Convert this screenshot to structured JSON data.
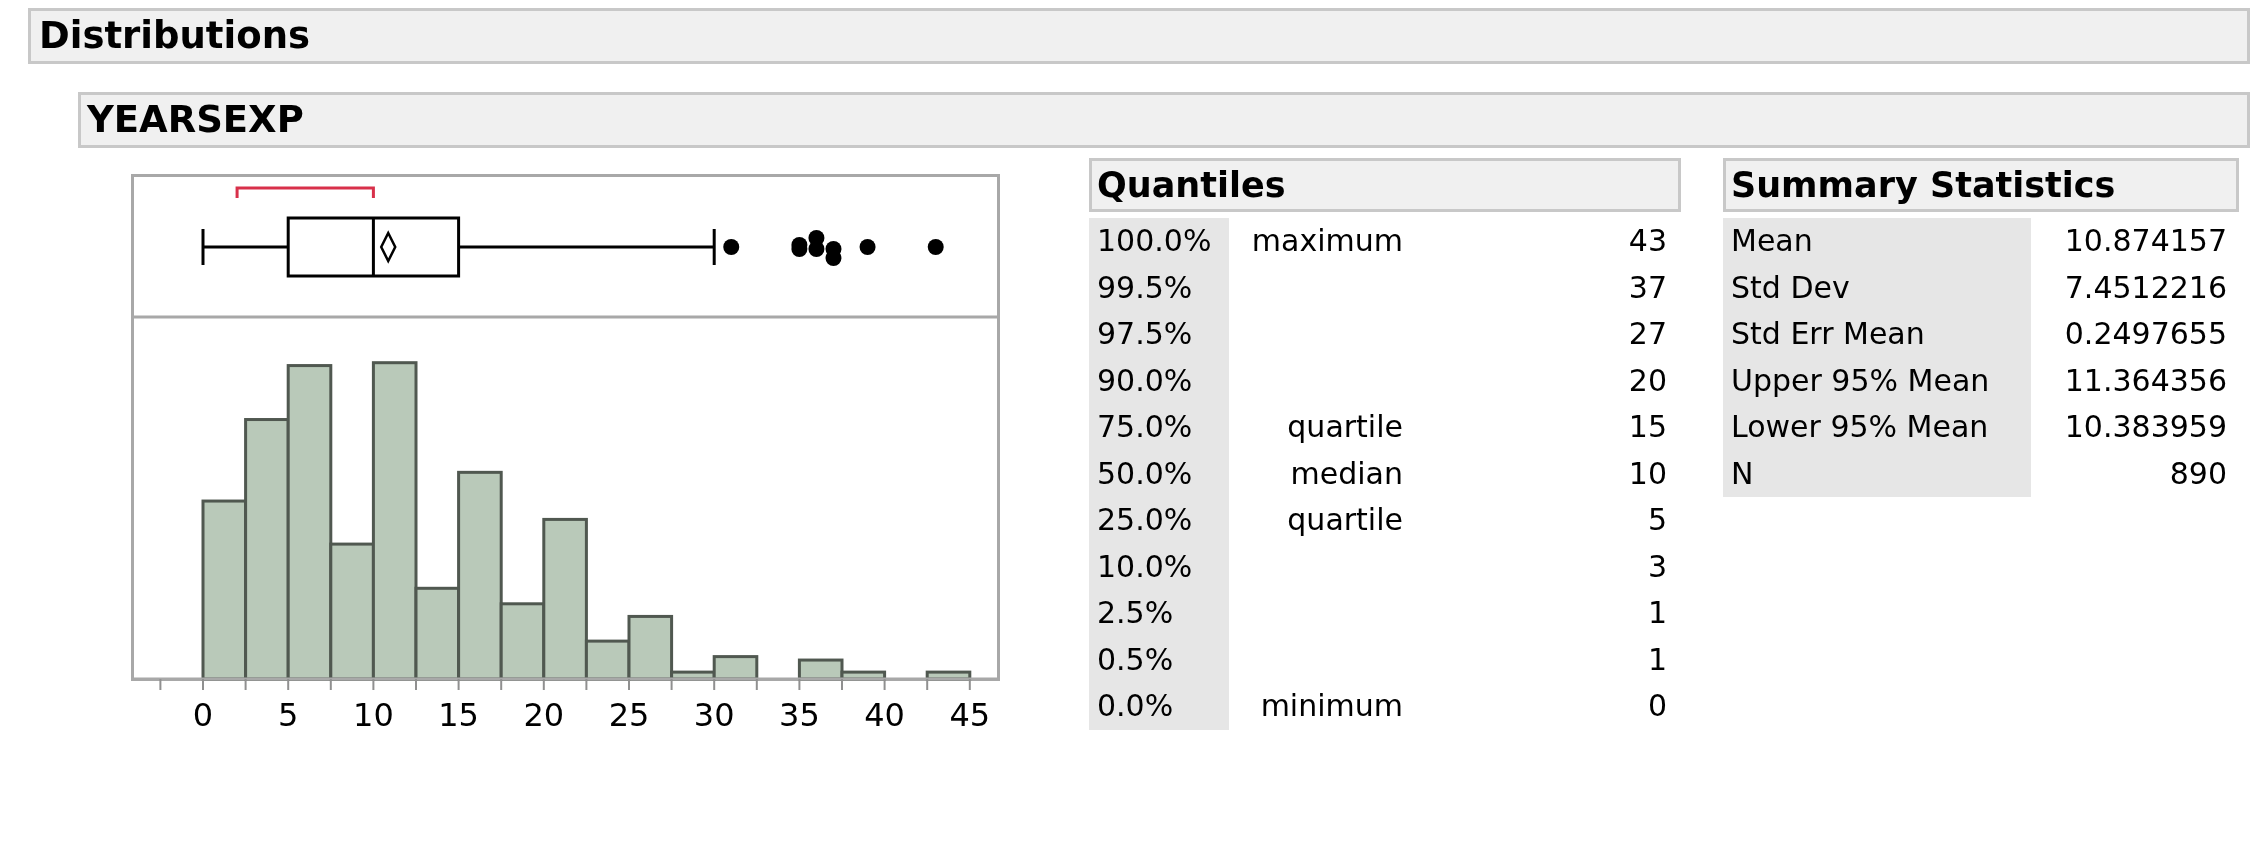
{
  "title": "Distributions",
  "variable": "YEARSEXP",
  "plot": {
    "axis_labels": [
      "0",
      "5",
      "10",
      "15",
      "20",
      "25",
      "30",
      "35",
      "40",
      "45"
    ]
  },
  "quantiles": {
    "title": "Quantiles",
    "rows": [
      {
        "percent": "100.0%",
        "label": "maximum",
        "value": "43"
      },
      {
        "percent": "99.5%",
        "label": "",
        "value": "37"
      },
      {
        "percent": "97.5%",
        "label": "",
        "value": "27"
      },
      {
        "percent": "90.0%",
        "label": "",
        "value": "20"
      },
      {
        "percent": "75.0%",
        "label": "quartile",
        "value": "15"
      },
      {
        "percent": "50.0%",
        "label": "median",
        "value": "10"
      },
      {
        "percent": "25.0%",
        "label": "quartile",
        "value": "5"
      },
      {
        "percent": "10.0%",
        "label": "",
        "value": "3"
      },
      {
        "percent": "2.5%",
        "label": "",
        "value": "1"
      },
      {
        "percent": "0.5%",
        "label": "",
        "value": "1"
      },
      {
        "percent": "0.0%",
        "label": "minimum",
        "value": "0"
      }
    ]
  },
  "summary": {
    "title": "Summary Statistics",
    "rows": [
      {
        "label": "Mean",
        "value": "10.874157"
      },
      {
        "label": "Std Dev",
        "value": "7.4512216"
      },
      {
        "label": "Std Err Mean",
        "value": "0.2497655"
      },
      {
        "label": "Upper 95% Mean",
        "value": "11.364356"
      },
      {
        "label": "Lower 95% Mean",
        "value": "10.383959"
      },
      {
        "label": "N",
        "value": "890"
      }
    ]
  }
}
